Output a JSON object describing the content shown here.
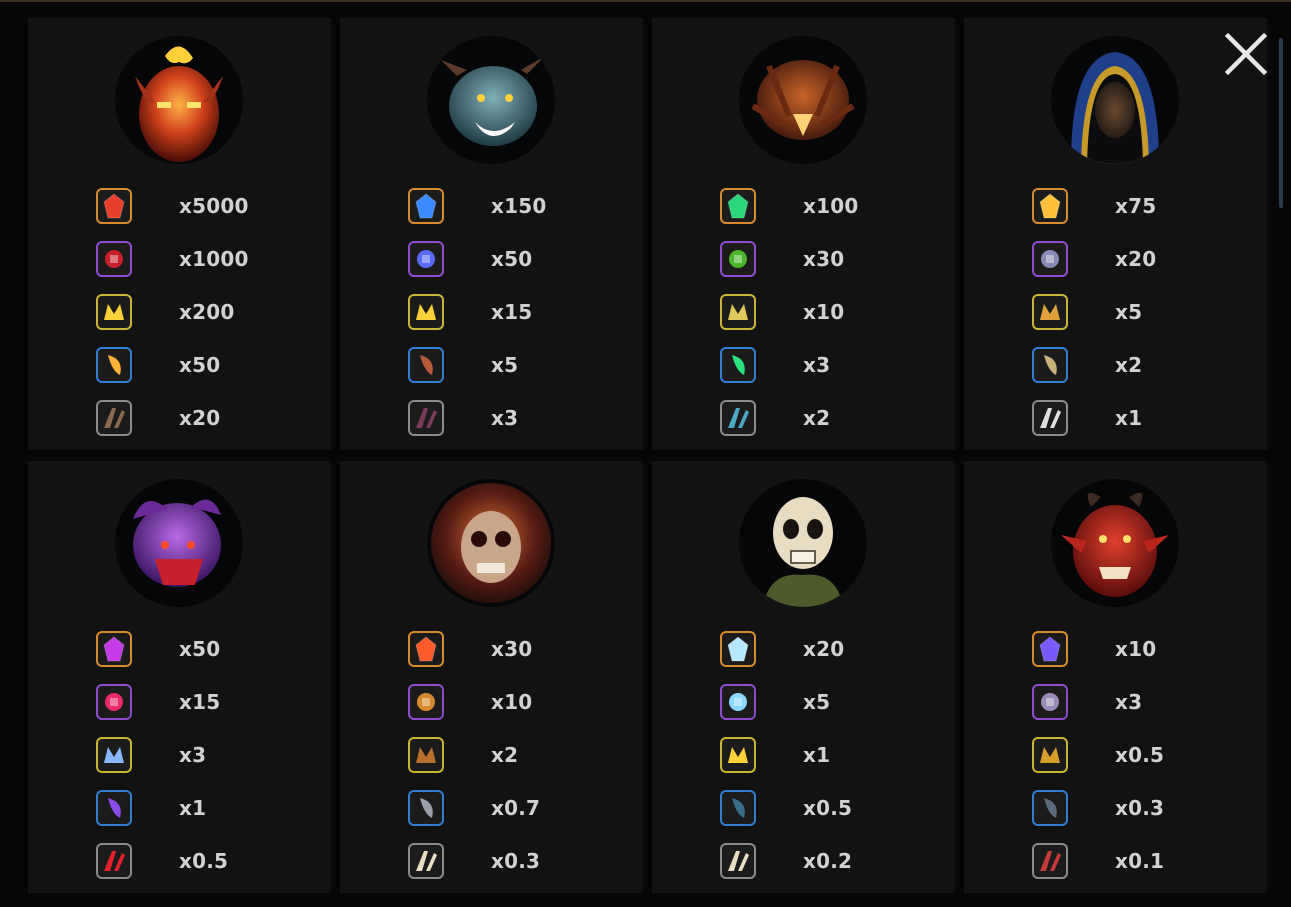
{
  "close_icon": "close-icon",
  "colors": {
    "background": "#060606",
    "card": "#121212",
    "text": "#d2d2d2",
    "frame_orange": "#d98a2b",
    "frame_purple": "#8e4bd1",
    "frame_yellow": "#c9b52f",
    "frame_blue": "#2f7fd6",
    "frame_gray": "#8a8a8a"
  },
  "paytable": [
    {
      "character": "fire-demon-portrait",
      "symbols": [
        {
          "icon": "ruby-gem-icon",
          "value": "x5000"
        },
        {
          "icon": "horned-helmet-icon",
          "value": "x1000"
        },
        {
          "icon": "golden-crown-icon",
          "value": "x200"
        },
        {
          "icon": "gold-horn-icon",
          "value": "x50"
        },
        {
          "icon": "claw-icon",
          "value": "x20"
        }
      ]
    },
    {
      "character": "goblin-portrait",
      "symbols": [
        {
          "icon": "blue-crystal-icon",
          "value": "x150"
        },
        {
          "icon": "bat-amulet-icon",
          "value": "x50"
        },
        {
          "icon": "gold-bat-icon",
          "value": "x15"
        },
        {
          "icon": "fang-icon",
          "value": "x5"
        },
        {
          "icon": "bat-wing-icon",
          "value": "x3"
        }
      ]
    },
    {
      "character": "spider-portrait",
      "symbols": [
        {
          "icon": "emerald-crystal-icon",
          "value": "x100"
        },
        {
          "icon": "spider-pendant-icon",
          "value": "x30"
        },
        {
          "icon": "spider-web-icon",
          "value": "x10"
        },
        {
          "icon": "green-potion-icon",
          "value": "x3"
        },
        {
          "icon": "scythe-icon",
          "value": "x2"
        }
      ]
    },
    {
      "character": "hooded-monk-portrait",
      "symbols": [
        {
          "icon": "gold-bars-icon",
          "value": "x75"
        },
        {
          "icon": "compass-medallion-icon",
          "value": "x20"
        },
        {
          "icon": "treasure-chest-icon",
          "value": "x5"
        },
        {
          "icon": "scroll-icon",
          "value": "x2"
        },
        {
          "icon": "candle-icon",
          "value": "x1"
        }
      ]
    },
    {
      "character": "purple-imp-portrait",
      "symbols": [
        {
          "icon": "purple-crystal-icon",
          "value": "x50"
        },
        {
          "icon": "heart-chain-icon",
          "value": "x15"
        },
        {
          "icon": "pearls-icon",
          "value": "x3"
        },
        {
          "icon": "purple-potion-icon",
          "value": "x1"
        },
        {
          "icon": "red-heart-icon",
          "value": "x0.5"
        }
      ]
    },
    {
      "character": "burning-skull-portrait",
      "symbols": [
        {
          "icon": "fire-gem-icon",
          "value": "x30"
        },
        {
          "icon": "beetle-amulet-icon",
          "value": "x10"
        },
        {
          "icon": "leather-armor-icon",
          "value": "x2"
        },
        {
          "icon": "shackles-icon",
          "value": "x0.7"
        },
        {
          "icon": "skull-icon",
          "value": "x0.3"
        }
      ]
    },
    {
      "character": "skeleton-portrait",
      "symbols": [
        {
          "icon": "ice-shards-icon",
          "value": "x20"
        },
        {
          "icon": "silver-ring-icon",
          "value": "x5"
        },
        {
          "icon": "gold-coins-icon",
          "value": "x1"
        },
        {
          "icon": "bomb-icon",
          "value": "x0.5"
        },
        {
          "icon": "crossbones-icon",
          "value": "x0.2"
        }
      ]
    },
    {
      "character": "red-demon-portrait",
      "symbols": [
        {
          "icon": "amethyst-icon",
          "value": "x10"
        },
        {
          "icon": "amethyst-ring-icon",
          "value": "x3"
        },
        {
          "icon": "gold-pouch-icon",
          "value": "x0.5"
        },
        {
          "icon": "tooth-necklace-icon",
          "value": "x0.3"
        },
        {
          "icon": "red-horn-icon",
          "value": "x0.1"
        }
      ]
    }
  ]
}
